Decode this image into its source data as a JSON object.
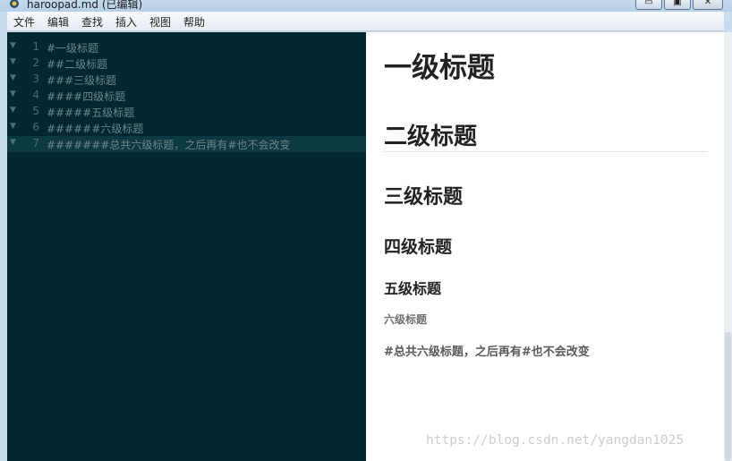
{
  "window": {
    "title": "haroopad.md (已编辑)",
    "controls": {
      "minimize": "▭",
      "maximize": "▣",
      "close": "✕"
    }
  },
  "menu": [
    "文件",
    "编辑",
    "查找",
    "插入",
    "视图",
    "帮助"
  ],
  "editor": {
    "active_line": 7,
    "lines": [
      {
        "num": "1",
        "text": "#一级标题"
      },
      {
        "num": "2",
        "text": "##二级标题"
      },
      {
        "num": "3",
        "text": "###三级标题"
      },
      {
        "num": "4",
        "text": "####四级标题"
      },
      {
        "num": "5",
        "text": "#####五级标题"
      },
      {
        "num": "6",
        "text": "######六级标题"
      },
      {
        "num": "7",
        "text": "#######总共六级标题，之后再有#也不会改变"
      }
    ]
  },
  "preview": {
    "h1": "一级标题",
    "h2": "二级标题",
    "h3": "三级标题",
    "h4": "四级标题",
    "h5": "五级标题",
    "h6": "六级标题",
    "extra": "#总共六级标题，之后再有#也不会改变"
  },
  "watermark": "https://blog.csdn.net/yangdan1025"
}
